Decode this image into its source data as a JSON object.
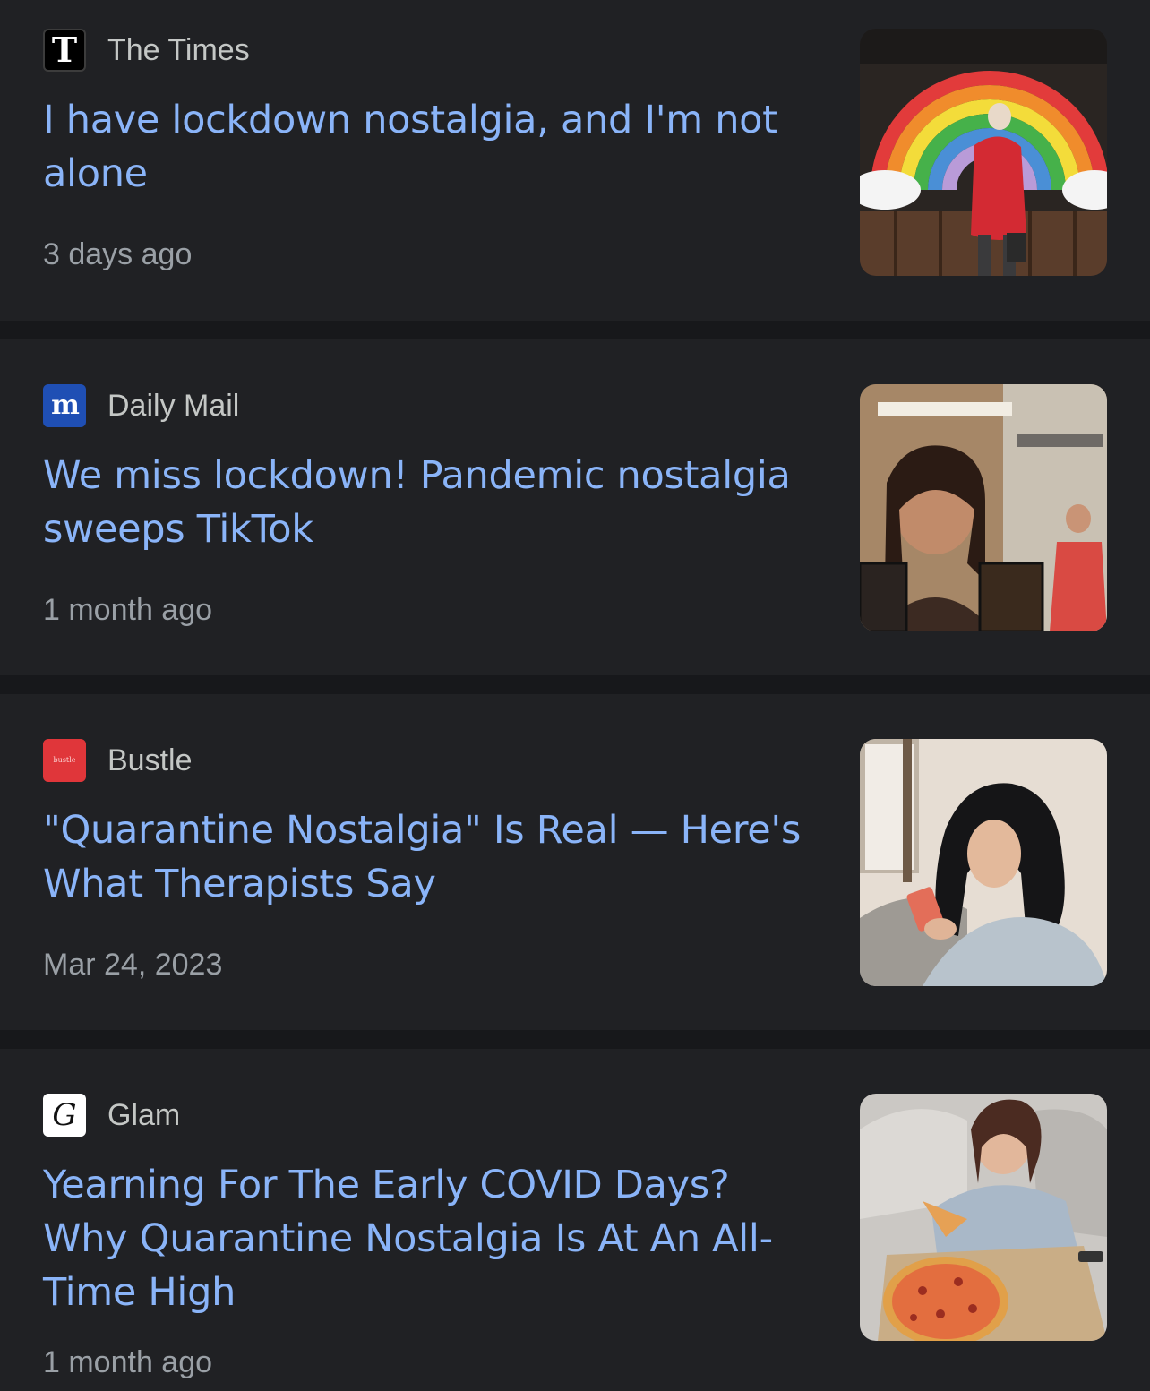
{
  "articles": [
    {
      "source": "The Times",
      "logo_glyph": "T",
      "logo_icon": "the-times-logo-icon",
      "headline": "I have lockdown nostalgia, and I'm not alone",
      "time": "3 days ago",
      "thumbnail": "rainbow-mural-photo"
    },
    {
      "source": "Daily Mail",
      "logo_glyph": "m",
      "logo_icon": "daily-mail-logo-icon",
      "headline": "We miss lockdown! Pandemic nostalgia sweeps TikTok",
      "time": "1 month ago",
      "thumbnail": "tiktok-collage-photo"
    },
    {
      "source": "Bustle",
      "logo_glyph": "bustle",
      "logo_icon": "bustle-logo-icon",
      "headline": "\"Quarantine Nostalgia\" Is Real — Here's What Therapists Say",
      "time": "Mar 24, 2023",
      "thumbnail": "woman-with-phone-photo"
    },
    {
      "source": "Glam",
      "logo_glyph": "G",
      "logo_icon": "glam-logo-icon",
      "headline": "Yearning For The Early COVID Days? Why Quarantine Nostalgia Is At An All-Time High",
      "time": "1 month ago",
      "thumbnail": "woman-with-pizza-photo"
    }
  ],
  "colors": {
    "page_background": "#17181b",
    "card_background": "#202124",
    "headline": "#8ab4f8",
    "source_text": "#c4c7c5",
    "time_text": "#9aa0a6"
  }
}
